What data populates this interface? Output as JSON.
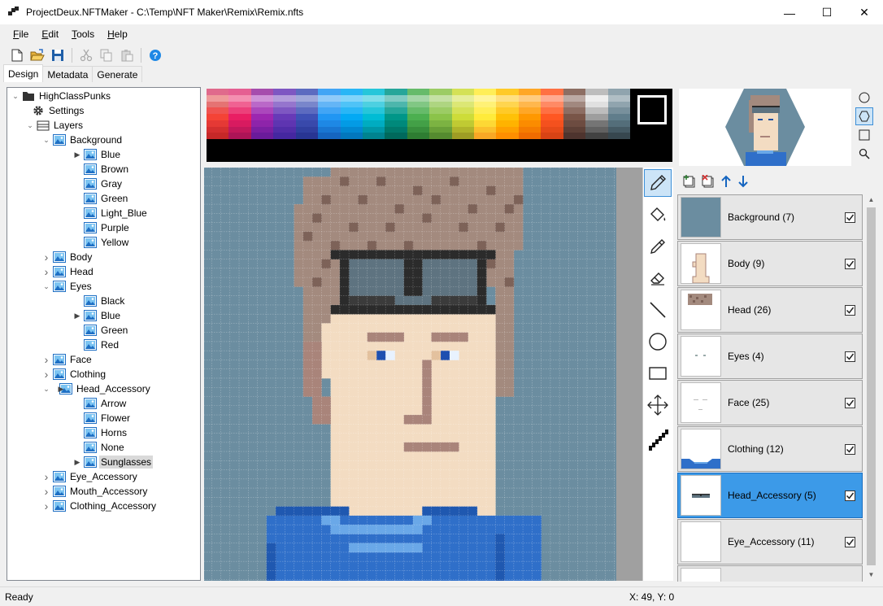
{
  "window": {
    "title": "ProjectDeux.NFTMaker - C:\\Temp\\NFT Maker\\Remix\\Remix.nfts",
    "minimize_glyph": "—",
    "maximize_glyph": "☐",
    "close_glyph": "✕"
  },
  "menu": {
    "items": [
      {
        "accel": "F",
        "rest": "ile"
      },
      {
        "accel": "E",
        "rest": "dit"
      },
      {
        "accel": "T",
        "rest": "ools"
      },
      {
        "accel": "H",
        "rest": "elp"
      }
    ]
  },
  "toolbar": {
    "icons": [
      "new-file-icon",
      "open-folder-icon",
      "save-icon",
      "cut-icon",
      "copy-icon",
      "paste-icon",
      "help-icon"
    ]
  },
  "tabs": [
    "Design",
    "Metadata",
    "Generate"
  ],
  "tree": {
    "root": "HighClassPunks",
    "settings": "Settings",
    "layers": "Layers",
    "nodes": [
      {
        "label": "Background",
        "depth": 3,
        "toggle": "open",
        "kind": "layer"
      },
      {
        "label": "Blue",
        "depth": 4,
        "toggle": "arrow",
        "kind": "image"
      },
      {
        "label": "Brown",
        "depth": 4,
        "toggle": "",
        "kind": "image"
      },
      {
        "label": "Gray",
        "depth": 4,
        "toggle": "",
        "kind": "image"
      },
      {
        "label": "Green",
        "depth": 4,
        "toggle": "",
        "kind": "image"
      },
      {
        "label": "Light_Blue",
        "depth": 4,
        "toggle": "",
        "kind": "image"
      },
      {
        "label": "Purple",
        "depth": 4,
        "toggle": "",
        "kind": "image"
      },
      {
        "label": "Yellow",
        "depth": 4,
        "toggle": "",
        "kind": "image"
      },
      {
        "label": "Body",
        "depth": 3,
        "toggle": "closed",
        "kind": "layer"
      },
      {
        "label": "Head",
        "depth": 3,
        "toggle": "closed",
        "kind": "layer"
      },
      {
        "label": "Eyes",
        "depth": 3,
        "toggle": "open",
        "kind": "layer"
      },
      {
        "label": "Black",
        "depth": 4,
        "toggle": "",
        "kind": "image"
      },
      {
        "label": "Blue",
        "depth": 4,
        "toggle": "arrow",
        "kind": "image"
      },
      {
        "label": "Green",
        "depth": 4,
        "toggle": "",
        "kind": "image"
      },
      {
        "label": "Red",
        "depth": 4,
        "toggle": "",
        "kind": "image"
      },
      {
        "label": "Face",
        "depth": 3,
        "toggle": "closed",
        "kind": "layer"
      },
      {
        "label": "Clothing",
        "depth": 3,
        "toggle": "closed",
        "kind": "layer"
      },
      {
        "label": "Head_Accessory",
        "depth": 3,
        "toggle": "open-arrow",
        "kind": "layer"
      },
      {
        "label": "Arrow",
        "depth": 4,
        "toggle": "",
        "kind": "image"
      },
      {
        "label": "Flower",
        "depth": 4,
        "toggle": "",
        "kind": "image"
      },
      {
        "label": "Horns",
        "depth": 4,
        "toggle": "",
        "kind": "image"
      },
      {
        "label": "None",
        "depth": 4,
        "toggle": "",
        "kind": "image"
      },
      {
        "label": "Sunglasses",
        "depth": 4,
        "toggle": "arrow",
        "kind": "image",
        "selected": true
      },
      {
        "label": "Eye_Accessory",
        "depth": 3,
        "toggle": "closed",
        "kind": "layer"
      },
      {
        "label": "Mouth_Accessory",
        "depth": 3,
        "toggle": "closed",
        "kind": "layer"
      },
      {
        "label": "Clothing_Accessory",
        "depth": 3,
        "toggle": "closed",
        "kind": "layer"
      }
    ]
  },
  "palette": {
    "columns": [
      [
        "#e06a8c",
        "#e55f92",
        "#a64dad",
        "#7e57c2",
        "#5c6bc0",
        "#42a5f5",
        "#29b6f6",
        "#26c6da",
        "#26a69a",
        "#66bb6a",
        "#9ccc65",
        "#d4e157",
        "#ffee58",
        "#ffca28",
        "#ffa726",
        "#ff7043",
        "#8d6e63",
        "#bdbdbd",
        "#90a4ae"
      ],
      [
        "#ef9a9a",
        "#f48fb1",
        "#ce93d8",
        "#b39ddb",
        "#9fa8da",
        "#90caf9",
        "#81d4fa",
        "#80deea",
        "#80cbc4",
        "#a5d6a7",
        "#c5e1a5",
        "#e6ee9c",
        "#fff59d",
        "#ffe082",
        "#ffcc80",
        "#ffab91",
        "#bcaaa4",
        "#eeeeee",
        "#b0bec5"
      ],
      [
        "#e57373",
        "#f06292",
        "#ba68c8",
        "#9575cd",
        "#7986cb",
        "#64b5f6",
        "#4fc3f7",
        "#4dd0e1",
        "#4db6ac",
        "#81c784",
        "#aed581",
        "#dce775",
        "#fff176",
        "#ffd54f",
        "#ffb74d",
        "#ff8a65",
        "#a1887f",
        "#e0e0e0",
        "#90a4ae"
      ],
      [
        "#ef5350",
        "#ec407a",
        "#ab47bc",
        "#7e57c2",
        "#5c6bc0",
        "#42a5f5",
        "#29b6f6",
        "#26c6da",
        "#26a69a",
        "#66bb6a",
        "#9ccc65",
        "#d4e157",
        "#ffee58",
        "#ffca28",
        "#ffa726",
        "#ff7043",
        "#8d6e63",
        "#bdbdbd",
        "#78909c"
      ],
      [
        "#f44336",
        "#e91e63",
        "#9c27b0",
        "#673ab7",
        "#3f51b5",
        "#2196f3",
        "#03a9f4",
        "#00bcd4",
        "#009688",
        "#4caf50",
        "#8bc34a",
        "#cddc39",
        "#ffeb3b",
        "#ffc107",
        "#ff9800",
        "#ff5722",
        "#795548",
        "#9e9e9e",
        "#607d8b"
      ],
      [
        "#e53935",
        "#d81b60",
        "#8e24aa",
        "#5e35b1",
        "#3949ab",
        "#1e88e5",
        "#039be5",
        "#00acc1",
        "#00897b",
        "#43a047",
        "#7cb342",
        "#c0ca33",
        "#fdd835",
        "#ffb300",
        "#fb8c00",
        "#f4511e",
        "#6d4c41",
        "#757575",
        "#546e7a"
      ],
      [
        "#d32f2f",
        "#c2185b",
        "#7b1fa2",
        "#512da8",
        "#303f9f",
        "#1976d2",
        "#0288d1",
        "#0097a7",
        "#00796b",
        "#388e3c",
        "#689f38",
        "#afb42b",
        "#fbc02d",
        "#ffa000",
        "#f57c00",
        "#e64a19",
        "#5d4037",
        "#616161",
        "#455a64"
      ],
      [
        "#c62828",
        "#ad1457",
        "#6a1b9a",
        "#4527a0",
        "#283593",
        "#1565c0",
        "#0277bd",
        "#00838f",
        "#00695c",
        "#2e7d32",
        "#558b2f",
        "#9e9d24",
        "#f9a825",
        "#ff8f00",
        "#ef6c00",
        "#d84315",
        "#4e342e",
        "#424242",
        "#37474f"
      ]
    ]
  },
  "tools": [
    {
      "name": "pencil-tool",
      "active": true
    },
    {
      "name": "fill-tool",
      "active": false
    },
    {
      "name": "eyedropper-tool",
      "active": false
    },
    {
      "name": "eraser-tool",
      "active": false
    },
    {
      "name": "line-tool",
      "active": false
    },
    {
      "name": "ellipse-tool",
      "active": false
    },
    {
      "name": "rectangle-tool",
      "active": false
    },
    {
      "name": "move-tool",
      "active": false
    },
    {
      "name": "brush-size-tool",
      "active": false
    }
  ],
  "layers": [
    {
      "name": "Background (7)",
      "thumb": "background",
      "checked": true,
      "selected": false
    },
    {
      "name": "Body (9)",
      "thumb": "body",
      "checked": true,
      "selected": false
    },
    {
      "name": "Head (26)",
      "thumb": "head",
      "checked": true,
      "selected": false
    },
    {
      "name": "Eyes (4)",
      "thumb": "eyes",
      "checked": true,
      "selected": false
    },
    {
      "name": "Face (25)",
      "thumb": "face",
      "checked": true,
      "selected": false
    },
    {
      "name": "Clothing (12)",
      "thumb": "clothing",
      "checked": true,
      "selected": false
    },
    {
      "name": "Head_Accessory (5)",
      "thumb": "sunglasses",
      "checked": true,
      "selected": true
    },
    {
      "name": "Eye_Accessory (11)",
      "thumb": "empty",
      "checked": true,
      "selected": false
    },
    {
      "name": "",
      "thumb": "empty",
      "checked": false,
      "selected": false
    }
  ],
  "status": {
    "text": "Ready",
    "coords": "X: 49, Y: 0"
  },
  "colors": {
    "background_pixel": "#6b8da0",
    "hair": "#a38a7e",
    "hair_dark": "#7d6258",
    "skin": "#f3dcc2",
    "skin_shadow": "#a9847a",
    "shirt": "#2f6fc9",
    "shirt_dark": "#1f58b0",
    "shirt_light": "#6aa8e8",
    "glasses_dark": "#2b2b2b",
    "glasses_lens": "#5e7380",
    "selected_layer": "#3c9ae8"
  }
}
